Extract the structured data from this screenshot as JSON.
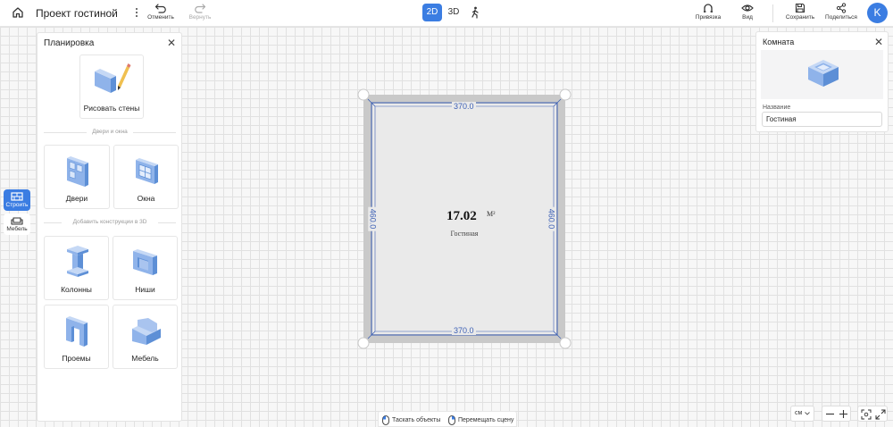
{
  "header": {
    "title": "Проект гостиной",
    "undo_label": "Отменить",
    "redo_label": "Вернуть",
    "modes": [
      "2D",
      "3D"
    ],
    "active_mode": "2D",
    "snap_label": "Привязка",
    "view_label": "Вид",
    "save_label": "Сохранить",
    "share_label": "Поделиться",
    "avatar_letter": "K"
  },
  "sidebar_tabs": [
    {
      "label": "Строить",
      "icon": "build-icon",
      "active": true
    },
    {
      "label": "Мебель",
      "icon": "sofa-icon",
      "active": false
    }
  ],
  "left_panel": {
    "title": "Планировка",
    "draw_walls_label": "Рисовать стены",
    "section_doors_windows": "Двери и окна",
    "doors_label": "Двери",
    "windows_label": "Окна",
    "section_constructions": "Добавить конструкции в 3D",
    "columns_label": "Колонны",
    "niches_label": "Ниши",
    "openings_label": "Проемы",
    "furniture_label": "Мебель"
  },
  "right_panel": {
    "title": "Комната",
    "name_label": "Название",
    "name_value": "Гостиная"
  },
  "plan": {
    "area_value": "17.02",
    "area_unit": "M²",
    "room_name": "Гостиная",
    "dim_top": "370.0",
    "dim_bottom": "370.0",
    "dim_left": "460.0",
    "dim_right": "460.0"
  },
  "bottom": {
    "drag_objects_label": "Таскать объекты",
    "move_scene_label": "Перемещать сцену",
    "unit_value": "см"
  },
  "colors": {
    "accent": "#3b7de2",
    "wall": "#c9c9c9",
    "floor": "#eaeaea",
    "dimension": "#3b5fb5"
  }
}
